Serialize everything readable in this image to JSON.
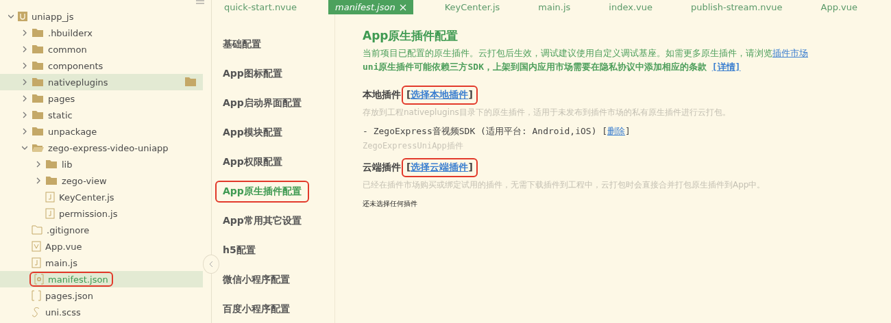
{
  "project_tree": {
    "name": "uniapp_js",
    "expanded": true,
    "children": [
      {
        "name": ".hbuilderx",
        "kind": "folder",
        "expanded": false,
        "selected": false,
        "highlighted": false
      },
      {
        "name": "common",
        "kind": "folder",
        "expanded": false,
        "selected": false,
        "highlighted": false
      },
      {
        "name": "components",
        "kind": "folder",
        "expanded": false,
        "selected": false,
        "highlighted": false
      },
      {
        "name": "nativeplugins",
        "kind": "folder",
        "expanded": false,
        "selected": true,
        "highlighted": false
      },
      {
        "name": "pages",
        "kind": "folder",
        "expanded": false,
        "selected": false,
        "highlighted": false
      },
      {
        "name": "static",
        "kind": "folder",
        "expanded": false,
        "selected": false,
        "highlighted": false
      },
      {
        "name": "unpackage",
        "kind": "folder",
        "expanded": false,
        "selected": false,
        "highlighted": false
      },
      {
        "name": "zego-express-video-uniapp",
        "kind": "folder",
        "expanded": true,
        "selected": false,
        "highlighted": false,
        "children": [
          {
            "name": "lib",
            "kind": "folder",
            "expanded": false,
            "selected": false,
            "highlighted": false
          },
          {
            "name": "zego-view",
            "kind": "folder",
            "expanded": false,
            "selected": false,
            "highlighted": false
          },
          {
            "name": "KeyCenter.js",
            "kind": "js",
            "selected": false,
            "highlighted": false
          },
          {
            "name": "permission.js",
            "kind": "js",
            "selected": false,
            "highlighted": false
          }
        ]
      },
      {
        "name": ".gitignore",
        "kind": "file",
        "selected": false,
        "highlighted": false
      },
      {
        "name": "App.vue",
        "kind": "vue",
        "selected": false,
        "highlighted": false
      },
      {
        "name": "main.js",
        "kind": "js",
        "selected": false,
        "highlighted": false
      },
      {
        "name": "manifest.json",
        "kind": "manifest",
        "selected": true,
        "highlighted": true
      },
      {
        "name": "pages.json",
        "kind": "json",
        "selected": false,
        "highlighted": false
      },
      {
        "name": "uni.scss",
        "kind": "scss",
        "selected": false,
        "highlighted": false
      }
    ]
  },
  "tabs": [
    {
      "label": "quick-start.nvue",
      "selected": false
    },
    {
      "label": "manifest.json",
      "selected": true
    },
    {
      "label": "KeyCenter.js",
      "selected": false
    },
    {
      "label": "main.js",
      "selected": false
    },
    {
      "label": "index.vue",
      "selected": false
    },
    {
      "label": "publish-stream.nvue",
      "selected": false
    },
    {
      "label": "App.vue",
      "selected": false
    }
  ],
  "settings_menu": [
    {
      "label": "基础配置",
      "selected": false,
      "highlighted": false
    },
    {
      "label": "App图标配置",
      "selected": false,
      "highlighted": false
    },
    {
      "label": "App启动界面配置",
      "selected": false,
      "highlighted": false
    },
    {
      "label": "App模块配置",
      "selected": false,
      "highlighted": false
    },
    {
      "label": "App权限配置",
      "selected": false,
      "highlighted": false
    },
    {
      "label": "App原生插件配置",
      "selected": true,
      "highlighted": true
    },
    {
      "label": "App常用其它设置",
      "selected": false,
      "highlighted": false
    },
    {
      "label": "h5配置",
      "selected": false,
      "highlighted": false
    },
    {
      "label": "微信小程序配置",
      "selected": false,
      "highlighted": false
    },
    {
      "label": "百度小程序配置",
      "selected": false,
      "highlighted": false
    }
  ],
  "content": {
    "title": "App原生插件配置",
    "intro": "当前项目已配置的原生插件。云打包后生效，调试建议使用自定义调试基座。如需更多原生插件，请浏览",
    "intro_link": "插件市场",
    "notice": "uni原生插件可能依赖三方SDK，上架到国内应用市场需要在隐私协议中添加相应的条款",
    "notice_link": "[详情]",
    "sections": [
      {
        "heading": "本地插件",
        "bracket_open": "[",
        "link": "选择本地插件",
        "bracket_close": "]",
        "highlighted": true,
        "description": "存放到工程nativeplugins目录下的原生插件，适用于未发布到插件市场的私有原生插件进行云打包。",
        "plugins": [
          {
            "name": "- ZegoExpress音视频SDK (适用平台: Android,iOS)",
            "bracket_open": "[",
            "action": "删除",
            "bracket_close": "]",
            "note": "ZegoExpressUniApp插件"
          }
        ]
      },
      {
        "heading": "云端插件",
        "bracket_open": "[",
        "link": "选择云端插件",
        "bracket_close": "]",
        "highlighted": true,
        "description": "已经在插件市场购买或绑定试用的插件，无需下载插件到工程中，云打包时会直接合并打包原生插件到App中。",
        "empty_text": "还未选择任何插件"
      }
    ]
  }
}
